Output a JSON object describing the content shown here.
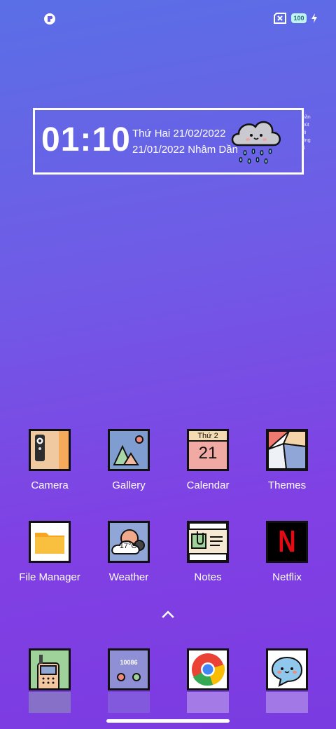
{
  "status_bar": {
    "battery": "100",
    "icons": [
      "app-indicator-icon",
      "sim-off-icon",
      "battery-icon",
      "charging-bolt-icon"
    ]
  },
  "widget": {
    "time": "01:10",
    "date_solar": "Thứ Hai 21/02/2022",
    "date_lunar": "21/01/2022 Nhâm Dần",
    "weather_icon": "rain-cloud-icon",
    "side_text": [
      "hần",
      "hút",
      "ối",
      "ộng",
      "ồ"
    ]
  },
  "apps": [
    {
      "label": "Camera",
      "icon": "camera-icon"
    },
    {
      "label": "Gallery",
      "icon": "gallery-icon"
    },
    {
      "label": "Calendar",
      "icon": "calendar-icon",
      "day_name": "Thứ 2",
      "day_number": "21"
    },
    {
      "label": "Themes",
      "icon": "themes-icon"
    },
    {
      "label": "File Manager",
      "icon": "folder-icon"
    },
    {
      "label": "Weather",
      "icon": "weather-icon",
      "temperature": "17°C"
    },
    {
      "label": "Notes",
      "icon": "notes-icon"
    },
    {
      "label": "Netflix",
      "icon": "netflix-icon",
      "letter": "N"
    }
  ],
  "dock": [
    {
      "icon": "phone-icon"
    },
    {
      "icon": "messages-icon",
      "number": "10086"
    },
    {
      "icon": "chrome-icon"
    },
    {
      "icon": "chat-bubble-icon"
    }
  ],
  "colors": {
    "gradient_top": "#5a6fe6",
    "gradient_bottom": "#7a3be0",
    "netflix_red": "#e50914"
  }
}
